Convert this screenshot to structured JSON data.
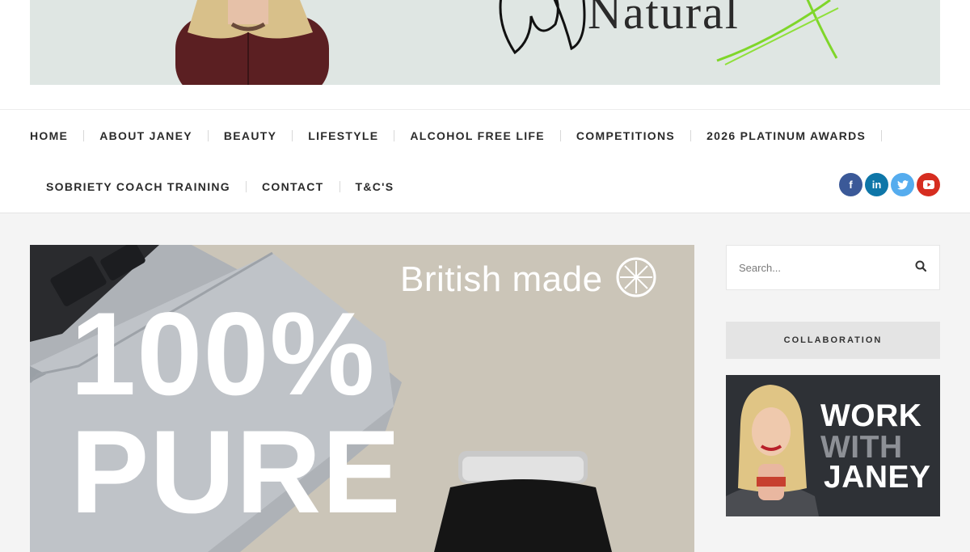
{
  "banner": {
    "word": "Natural"
  },
  "nav": {
    "row1": [
      "HOME",
      "ABOUT JANEY",
      "BEAUTY",
      "LIFESTYLE",
      "ALCOHOL FREE LIFE",
      "COMPETITIONS",
      "2026 PLATINUM AWARDS"
    ],
    "row2": [
      "SOBRIETY COACH TRAINING",
      "CONTACT",
      "T&C'S"
    ]
  },
  "social": [
    {
      "icon": "facebook-icon",
      "glyph": "f",
      "color": "#3b5998"
    },
    {
      "icon": "linkedin-icon",
      "glyph": "in",
      "color": "#0e76a8"
    },
    {
      "icon": "twitter-icon",
      "glyph": "t",
      "color": "#55acee"
    },
    {
      "icon": "youtube-icon",
      "glyph": "▶",
      "color": "#d62d20"
    }
  ],
  "feature": {
    "line1": "British made",
    "line2": "100% PURE"
  },
  "search": {
    "placeholder": "Search..."
  },
  "sidebar": {
    "widget_title": "COLLABORATION",
    "promo": {
      "line1": "WORK",
      "line2": "WITH",
      "line3": "JANEY"
    }
  },
  "colors": {
    "accent_green": "#7fd62a",
    "promo_bg": "#2e3136"
  }
}
